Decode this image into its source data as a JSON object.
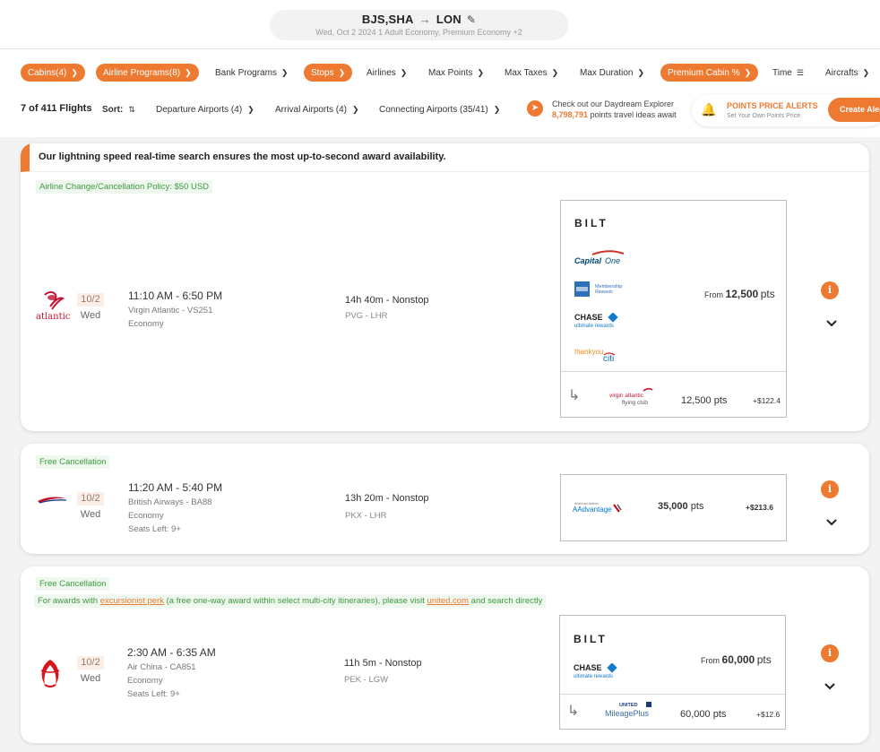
{
  "search": {
    "route_from": "BJS,SHA",
    "route_to": "LON",
    "details": "Wed, Oct 2 2024  1 Adult  Economy, Premium Economy +2"
  },
  "filters": {
    "row1": [
      "Cabins(4)",
      "Airline Programs(8)",
      "Bank Programs",
      "Stops",
      "Airlines",
      "Max Points",
      "Max Taxes",
      "Max Duration",
      "Premium Cabin %",
      "Time",
      "Aircrafts"
    ],
    "active": [
      "Cabins(4)",
      "Airline Programs(8)",
      "Stops",
      "Premium Cabin %"
    ],
    "count": "7 of 411 Flights",
    "sort_label": "Sort:",
    "sort_icon": "sort-arrows-icon",
    "departure": "Departure Airports (4)",
    "arrival": "Arrival Airports (4)",
    "connecting": "Connecting Airports (35/41)"
  },
  "promo": {
    "line1": "Check out our Daydream Explorer",
    "number": "8,798,791",
    "line2_rest": " points travel ideas await"
  },
  "alerts": {
    "title": "POINTS PRICE ALERTS",
    "subtitle": "Set Your Own Points Price",
    "button": "Create Alert"
  },
  "banner": "Our lightning speed real-time search ensures the most up-to-second award availability.",
  "flights": [
    {
      "tag": "Airline Change/Cancellation Policy: $50 USD",
      "airline_logo": "virgin-atlantic-logo",
      "logo_text": "atlantic",
      "date": "10/2",
      "weekday": "Wed",
      "times": "11:10 AM - 6:50 PM",
      "flight": "Virgin Atlantic - VS251",
      "cabin": "Economy",
      "seats": "",
      "duration": "14h 40m - Nonstop",
      "airports": "PVG - LHR",
      "programs": [
        "BILT",
        "CapitalOne",
        "Membership Rewards",
        "CHASE ultimate rewards",
        "thankyou citi"
      ],
      "from_label": "From",
      "from_points": "12,500",
      "pts_unit": "pts",
      "transfer_program": "virgin atlantic flying club",
      "transfer_points": "12,500 pts",
      "taxes": "+$122.4"
    },
    {
      "tag": "Free Cancellation",
      "airline_logo": "british-airways-logo",
      "date": "10/2",
      "weekday": "Wed",
      "times": "11:20 AM - 5:40 PM",
      "flight": "British Airways - BA88",
      "cabin": "Economy",
      "seats": "Seats Left: 9+",
      "duration": "13h 20m - Nonstop",
      "airports": "PKX - LHR",
      "program": "AAdvantage",
      "points": "35,000",
      "pts_unit": "pts",
      "taxes": "+$213.6"
    },
    {
      "tag": "Free Cancellation",
      "note_prefix": "For awards with ",
      "note_link": "excursionist perk",
      "note_middle": " (a free one-way award within select multi-city itineraries), please visit ",
      "note_link2": "united.com",
      "note_suffix": " and search directly",
      "airline_logo": "air-china-logo",
      "date": "10/2",
      "weekday": "Wed",
      "times": "2:30 AM - 6:35 AM",
      "flight": "Air China - CA851",
      "cabin": "Economy",
      "seats": "Seats Left: 9+",
      "duration": "11h 5m - Nonstop",
      "airports": "PEK - LGW",
      "programs": [
        "BILT",
        "CHASE ultimate rewards"
      ],
      "from_label": "From",
      "from_points": "60,000",
      "pts_unit": "pts",
      "transfer_program": "UNITED MileagePlus",
      "transfer_points": "60,000 pts",
      "taxes": "+$12.6"
    }
  ],
  "colors": {
    "accent": "#ee7a32",
    "tag_bg": "#eef8ee",
    "tag_text": "#3f9a3f"
  }
}
